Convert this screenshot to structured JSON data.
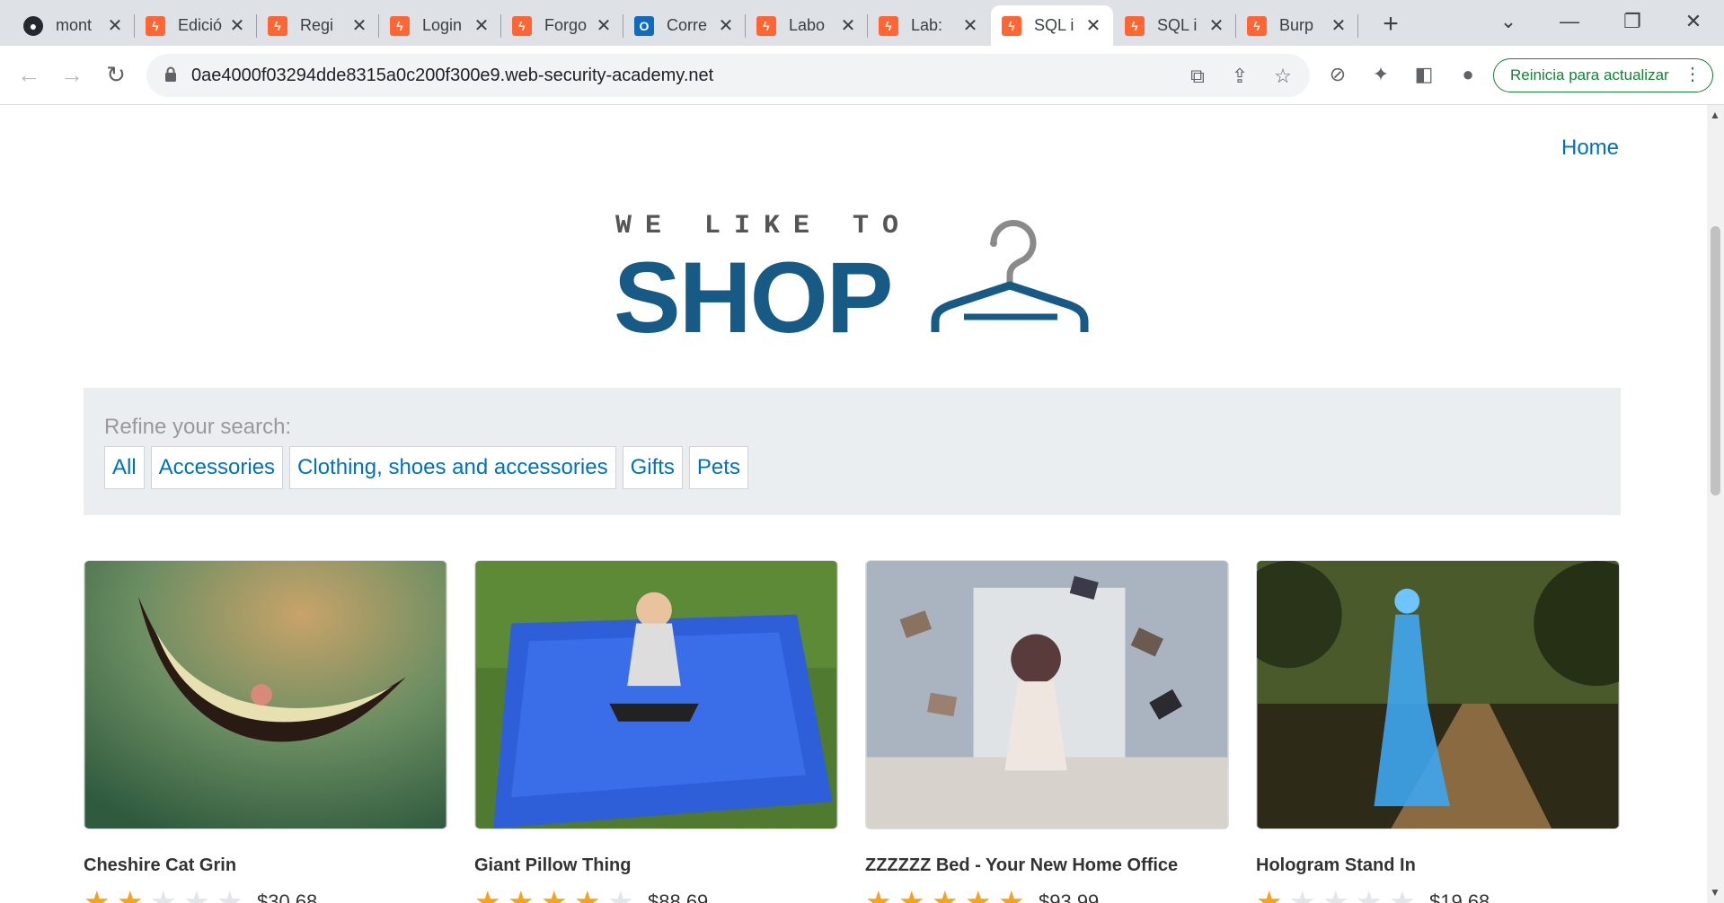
{
  "browser": {
    "tabs": [
      {
        "title": "mont",
        "icon": "github-icon"
      },
      {
        "title": "Edició",
        "icon": "portswigger-icon"
      },
      {
        "title": "Regi",
        "icon": "portswigger-icon"
      },
      {
        "title": "Login",
        "icon": "portswigger-icon"
      },
      {
        "title": "Forgo",
        "icon": "portswigger-icon"
      },
      {
        "title": "Corre",
        "icon": "outlook-icon"
      },
      {
        "title": "Labo",
        "icon": "portswigger-icon"
      },
      {
        "title": "Lab: ",
        "icon": "portswigger-icon"
      },
      {
        "title": "SQL i",
        "icon": "portswigger-icon",
        "active": true
      },
      {
        "title": "SQL i",
        "icon": "portswigger-icon"
      },
      {
        "title": "Burp",
        "icon": "portswigger-icon"
      }
    ],
    "close_glyph": "✕",
    "new_tab_glyph": "+",
    "url": "0ae4000f03294dde8315a0c200f300e9.web-security-academy.net",
    "update_button": "Reinicia para actualizar"
  },
  "page": {
    "home_link": "Home",
    "logo": {
      "tagline": "WE LIKE TO",
      "wordmark": "SHOP"
    },
    "filter": {
      "label": "Refine your search:",
      "categories": [
        "All",
        "Accessories",
        "Clothing, shoes and accessories",
        "Gifts",
        "Pets"
      ]
    },
    "products": [
      {
        "name": "Cheshire Cat Grin",
        "rating": 2,
        "price": "$30.68"
      },
      {
        "name": "Giant Pillow Thing",
        "rating": 4,
        "price": "$88.69"
      },
      {
        "name": "ZZZZZZ Bed - Your New Home Office",
        "rating": 5,
        "price": "$93.99"
      },
      {
        "name": "Hologram Stand In",
        "rating": 1,
        "price": "$19.68"
      }
    ]
  },
  "colors": {
    "link": "#0071bc",
    "logo_blue": "#165a85",
    "star_on": "#f6a21a",
    "star_off": "#e3e5e8",
    "update_green": "#188038"
  }
}
